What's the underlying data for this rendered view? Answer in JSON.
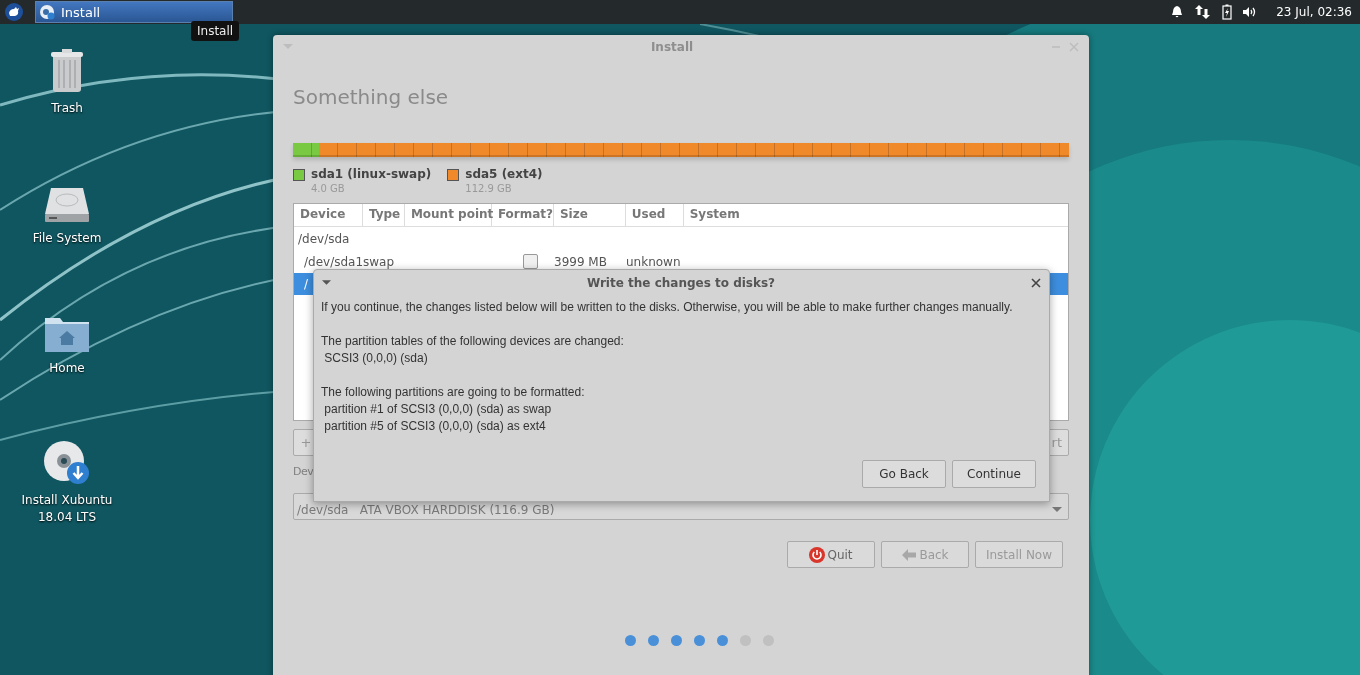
{
  "top_panel": {
    "taskbar_button": {
      "label": "Install",
      "selected": true
    },
    "tooltip": "Install",
    "clock": "23 Jul, 02:36"
  },
  "desktop_icons": [
    {
      "kind": "trash",
      "lines": [
        "Trash"
      ]
    },
    {
      "kind": "drive",
      "lines": [
        "File System"
      ]
    },
    {
      "kind": "home",
      "lines": [
        "Home"
      ]
    },
    {
      "kind": "installer",
      "lines": [
        "Install Xubuntu",
        "18.04 LTS"
      ]
    }
  ],
  "window": {
    "title": "Install",
    "heading": "Something else",
    "partitions": [
      {
        "name": "sda1 (linux-swap)",
        "size": "4.0 GB",
        "color": "#7ac943",
        "level": 0.034
      },
      {
        "name": "sda5 (ext4)",
        "size": "112.9 GB",
        "color": "#f0892a",
        "level": 0.966
      }
    ],
    "table": {
      "columns": [
        "Device",
        "Type",
        "Mount point",
        "Format?",
        "Size",
        "Used",
        "System"
      ],
      "rows": [
        {
          "kind": "disk",
          "device": "/dev/sda",
          "selected": false
        },
        {
          "kind": "partition",
          "device": "/dev/sda1",
          "type": "swap",
          "format": false,
          "size": "3999 MB",
          "used": "unknown",
          "selected": false
        },
        {
          "kind": "partition",
          "device": "/",
          "selected": true
        }
      ]
    },
    "table_buttons": [
      {
        "label": "+"
      },
      {
        "label": "rt"
      }
    ],
    "device_label": "Dev",
    "device_dropdown": {
      "value": "/dev/sda   ATA VBOX HARDDISK (116.9 GB)"
    },
    "nav_buttons": [
      {
        "kind": "quit",
        "label": "Quit",
        "disabled": false
      },
      {
        "kind": "back",
        "label": "Back",
        "disabled": true
      },
      {
        "kind": "install",
        "label": "Install Now",
        "disabled": true
      }
    ],
    "steps": [
      {
        "done": true
      },
      {
        "done": true
      },
      {
        "done": true
      },
      {
        "done": true
      },
      {
        "done": true
      },
      {
        "done": false
      },
      {
        "done": false
      }
    ]
  },
  "dialog": {
    "title": "Write the changes to disks?",
    "paragraphs": [
      [
        "If you continue, the changes listed below will be written to the disks. Otherwise, you will be able to make further changes manually."
      ],
      [
        "The partition tables of the following devices are changed:",
        " SCSI3 (0,0,0) (sda)"
      ],
      [
        "The following partitions are going to be formatted:",
        " partition #1 of SCSI3 (0,0,0) (sda) as swap",
        " partition #5 of SCSI3 (0,0,0) (sda) as ext4"
      ]
    ],
    "buttons": [
      "Go Back",
      "Continue"
    ]
  }
}
